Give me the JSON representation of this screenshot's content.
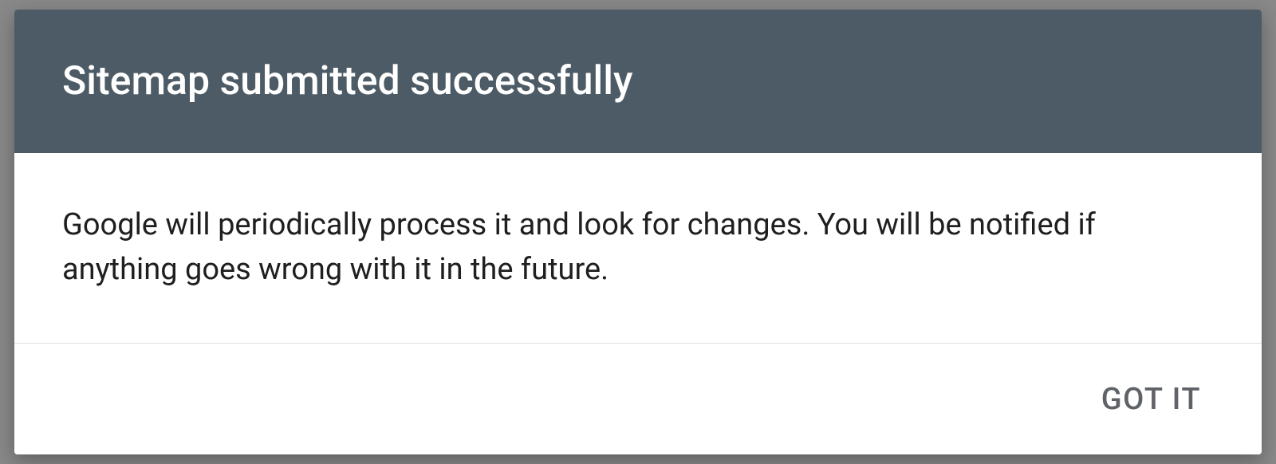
{
  "dialog": {
    "title": "Sitemap submitted successfully",
    "message": "Google will periodically process it and look for changes. You will be notified if anything goes wrong with it in the future.",
    "confirm_label": "GOT IT"
  }
}
